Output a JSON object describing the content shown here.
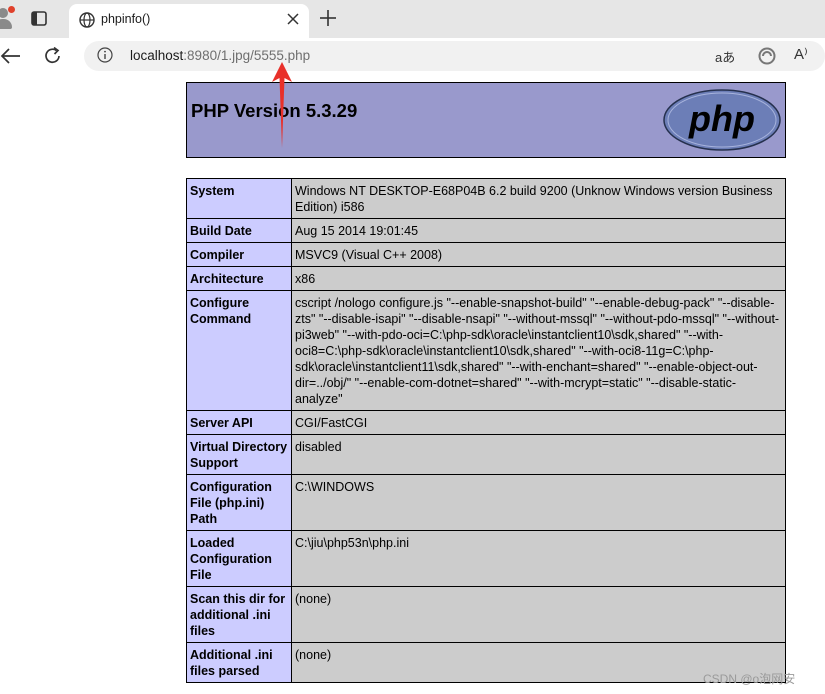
{
  "browser": {
    "tab_title": "phpinfo()",
    "url_host": "localhost",
    "url_rest": ":8980/1.jpg/5555.php",
    "read_aloud": "aあ",
    "font_label": "A⁾"
  },
  "page": {
    "php_version_title": "PHP Version 5.3.29",
    "logo_text": "php",
    "rows": [
      {
        "label": "System",
        "value": "Windows NT DESKTOP-E68P04B 6.2 build 9200 (Unknow Windows version Business Edition) i586"
      },
      {
        "label": "Build Date",
        "value": "Aug 15 2014 19:01:45"
      },
      {
        "label": "Compiler",
        "value": "MSVC9 (Visual C++ 2008)"
      },
      {
        "label": "Architecture",
        "value": "x86"
      },
      {
        "label": "Configure Command",
        "value": "cscript /nologo configure.js \"--enable-snapshot-build\" \"--enable-debug-pack\" \"--disable-zts\" \"--disable-isapi\" \"--disable-nsapi\" \"--without-mssql\" \"--without-pdo-mssql\" \"--without-pi3web\" \"--with-pdo-oci=C:\\php-sdk\\oracle\\instantclient10\\sdk,shared\" \"--with-oci8=C:\\php-sdk\\oracle\\instantclient10\\sdk,shared\" \"--with-oci8-11g=C:\\php-sdk\\oracle\\instantclient11\\sdk,shared\" \"--with-enchant=shared\" \"--enable-object-out-dir=../obj/\" \"--enable-com-dotnet=shared\" \"--with-mcrypt=static\" \"--disable-static-analyze\""
      },
      {
        "label": "Server API",
        "value": "CGI/FastCGI"
      },
      {
        "label": "Virtual Directory Support",
        "value": "disabled"
      },
      {
        "label": "Configuration File (php.ini) Path",
        "value": "C:\\WINDOWS"
      },
      {
        "label": "Loaded Configuration File",
        "value": "C:\\jiu\\php53n\\php.ini"
      },
      {
        "label": "Scan this dir for additional .ini files",
        "value": "(none)"
      },
      {
        "label": "Additional .ini files parsed",
        "value": "(none)"
      }
    ]
  },
  "watermark": "CSDN @o泡网安",
  "colors": {
    "banner": "#9999cc",
    "label_cell": "#ccccff",
    "value_cell": "#cccccc",
    "arrow": "#e8302a"
  }
}
